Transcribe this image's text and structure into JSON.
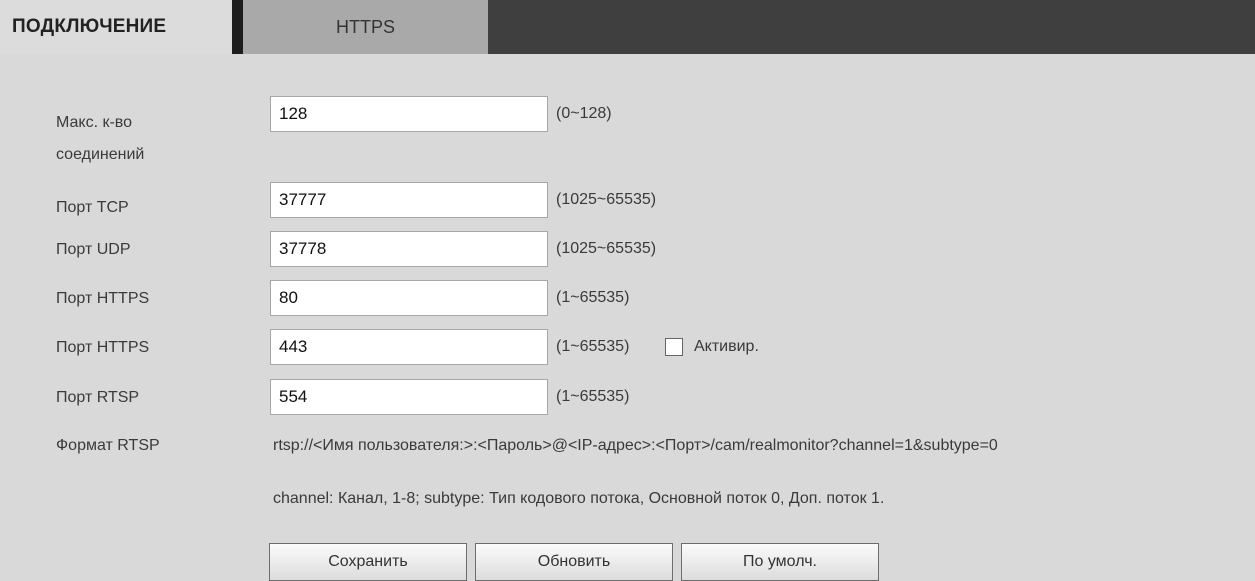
{
  "tabs": {
    "active_label": "ПОДКЛЮЧЕНИЕ",
    "inactive_label": "HTTPS"
  },
  "form": {
    "max_connections": {
      "label_line1": "Макс. к-во",
      "label_line2": "соединений",
      "value": "128",
      "range": "(0~128)"
    },
    "tcp_port": {
      "label": "Порт TCP",
      "value": "37777",
      "range": "(1025~65535)"
    },
    "udp_port": {
      "label": "Порт UDP",
      "value": "37778",
      "range": "(1025~65535)"
    },
    "http_port": {
      "label": "Порт HTTPS",
      "value": "80",
      "range": "(1~65535)"
    },
    "https_port": {
      "label": "Порт HTTPS",
      "value": "443",
      "range": "(1~65535)",
      "enable_label": "Активир.",
      "enabled": false
    },
    "rtsp_port": {
      "label": "Порт RTSP",
      "value": "554",
      "range": "(1~65535)"
    },
    "rtsp_format": {
      "label": "Формат RTSP",
      "url": "rtsp://<Имя пользователя:>:<Пароль>@<IP-адрес>:<Порт>/cam/realmonitor?channel=1&subtype=0",
      "note": "channel: Канал, 1-8; subtype: Тип кодового потока, Основной поток 0, Доп. поток 1."
    }
  },
  "buttons": {
    "save": "Сохранить",
    "refresh": "Обновить",
    "default": "По умолч."
  }
}
